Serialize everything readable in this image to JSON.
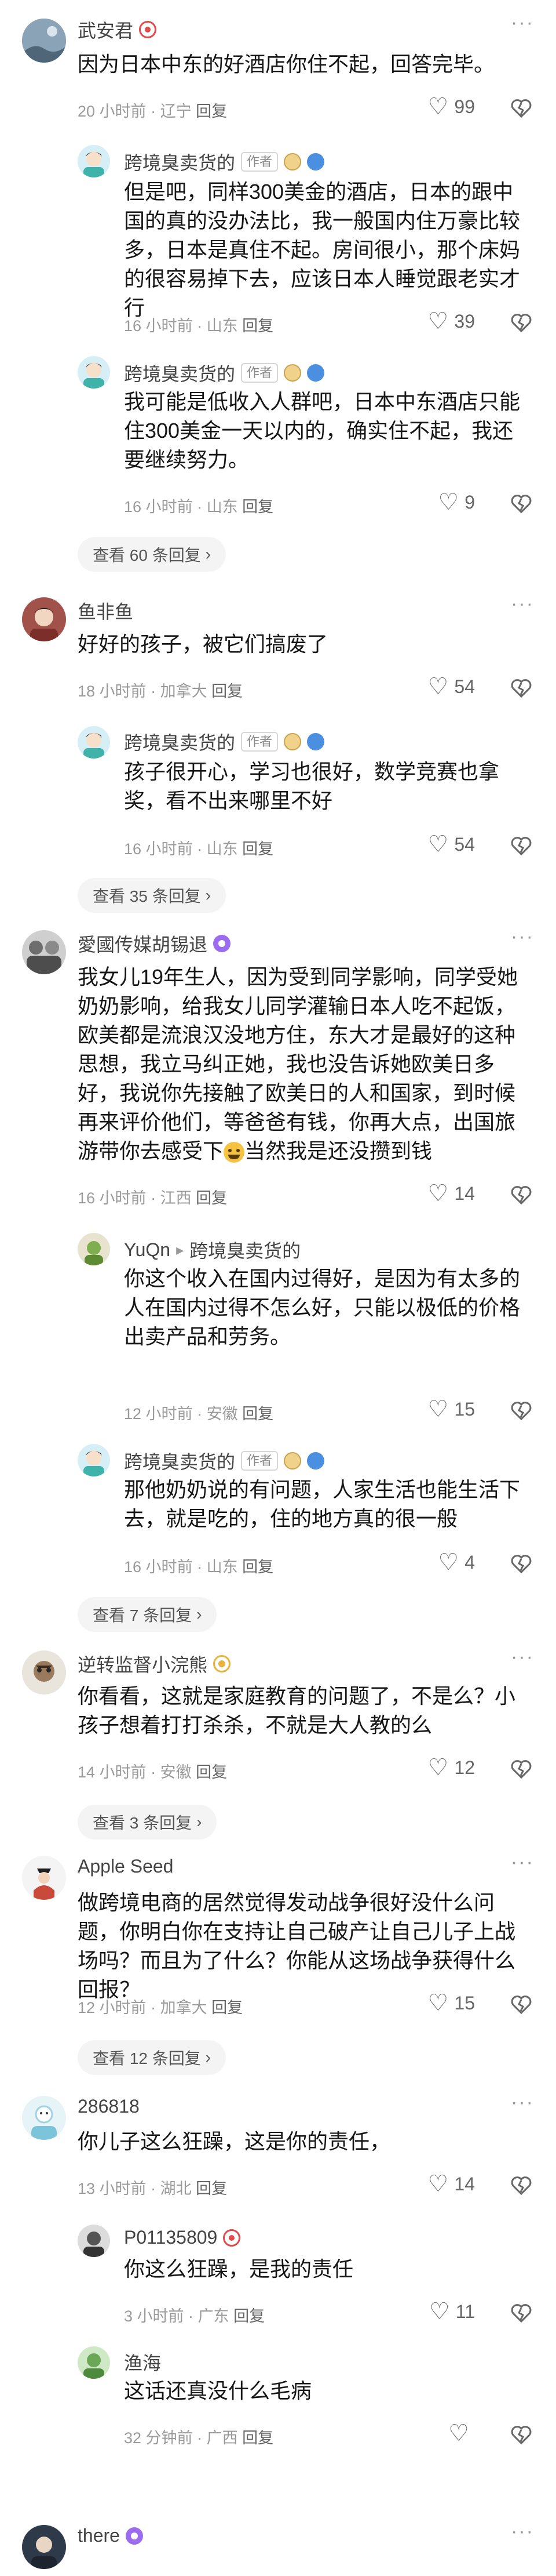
{
  "colors": {
    "vip_badge": "#e04a4a",
    "author_tag_border": "#d6d6d6",
    "meta_text": "#9a9a9a",
    "background": "#ffffff",
    "view_more_bg": "#f4f4f4",
    "purple_badge": "#9b6cf0",
    "yellow_badge": "#e8b43c",
    "blue_badge": "#4a8fe0"
  },
  "comments": [
    {
      "user": "武安君",
      "text": "因为日本中东的好酒店你住不起，回答完毕。",
      "time": "20 小时前",
      "location": "辽宁",
      "reply": "回复",
      "likes": "99",
      "replies": [
        {
          "user": "跨境臭卖货的",
          "tag": "作者",
          "text": "但是吧，同样300美金的酒店，日本的跟中国的真的没办法比，我一般国内住万豪比较多，日本是真住不起。房间很小，那个床妈的很容易掉下去，应该日本人睡觉跟老实才行",
          "time": "16 小时前",
          "location": "山东",
          "reply": "回复",
          "likes": "39"
        },
        {
          "user": "跨境臭卖货的",
          "tag": "作者",
          "text": "我可能是低收入人群吧，日本中东酒店只能住300美金一天以内的，确实住不起，我还要继续努力。",
          "time": "16 小时前",
          "location": "山东",
          "reply": "回复",
          "likes": "9"
        }
      ],
      "view_more": "查看 60 条回复"
    },
    {
      "user": "鱼非鱼",
      "text": "好好的孩子，被它们搞废了",
      "time": "18 小时前",
      "location": "加拿大",
      "reply": "回复",
      "likes": "54",
      "replies": [
        {
          "user": "跨境臭卖货的",
          "tag": "作者",
          "text": "孩子很开心，学习也很好，数学竞赛也拿奖，看不出来哪里不好",
          "time": "16 小时前",
          "location": "山东",
          "reply": "回复",
          "likes": "54"
        }
      ],
      "view_more": "查看 35 条回复"
    },
    {
      "user": "愛國传媒胡锡退",
      "text": "我女儿19年生人，因为受到同学影响，同学受她奶奶影响，给我女儿同学灌输日本人吃不起饭，欧美都是流浪汉没地方住，东大才是最好的这种思想，我立马纠正她，我也没告诉她欧美日多好，我说你先接触了欧美日的人和国家，到时候再来评价他们，等爸爸有钱，你再大点，出国旅游带你去感受下",
      "text_after_emoji": "当然我是还没攒到钱",
      "time": "16 小时前",
      "location": "江西",
      "reply": "回复",
      "likes": "14",
      "replies": [
        {
          "user": "YuQn",
          "reply_to": "跨境臭卖货的",
          "text": "你这个收入在国内过得好，是因为有太多的人在国内过得不怎么好，只能以极低的价格出卖产品和劳务。",
          "time": "12 小时前",
          "location": "安徽",
          "reply": "回复",
          "likes": "15"
        },
        {
          "user": "跨境臭卖货的",
          "tag": "作者",
          "text": "那他奶奶说的有问题，人家生活也能生活下去，就是吃的，住的地方真的很一般",
          "time": "16 小时前",
          "location": "山东",
          "reply": "回复",
          "likes": "4"
        }
      ],
      "view_more": "查看 7 条回复"
    },
    {
      "user": "逆转监督小浣熊",
      "text": "你看看，这就是家庭教育的问题了，不是么？小孩子想着打打杀杀，不就是大人教的么",
      "time": "14 小时前",
      "location": "安徽",
      "reply": "回复",
      "likes": "12",
      "replies": [],
      "view_more": "查看 3 条回复"
    },
    {
      "user": "Apple Seed",
      "text": "做跨境电商的居然觉得发动战争很好没什么问题，你明白你在支持让自己破产让自己儿子上战场吗？而且为了什么？你能从这场战争获得什么回报？",
      "time": "12 小时前",
      "location": "加拿大",
      "reply": "回复",
      "likes": "15",
      "replies": [],
      "view_more": "查看 12 条回复"
    },
    {
      "user": "286818",
      "text": "你儿子这么狂躁，这是你的责任，",
      "time": "13 小时前",
      "location": "湖北",
      "reply": "回复",
      "likes": "14",
      "replies": [
        {
          "user": "P01135809",
          "text": "你这么狂躁，是我的责任",
          "time": "3 小时前",
          "location": "广东",
          "reply": "回复",
          "likes": "11"
        },
        {
          "user": "渔海",
          "text": "这话还真没什么毛病",
          "time": "32 分钟前",
          "location": "广西",
          "reply": "回复",
          "likes": ""
        }
      ],
      "view_more": ""
    },
    {
      "user": "there",
      "text": "",
      "time": "",
      "location": "",
      "reply": "",
      "likes": "",
      "replies": [],
      "view_more": ""
    }
  ],
  "icons": {
    "more": "more-dots-icon",
    "like": "heart-outline-icon",
    "dislike": "dislike-broken-heart-icon",
    "expand": "chevron-right-icon",
    "reply_arrow": "play-arrow-icon"
  },
  "glyphs": {
    "more": "···",
    "heart": "♡",
    "chevron": "›",
    "arrow": "▸",
    "dot": "·"
  }
}
